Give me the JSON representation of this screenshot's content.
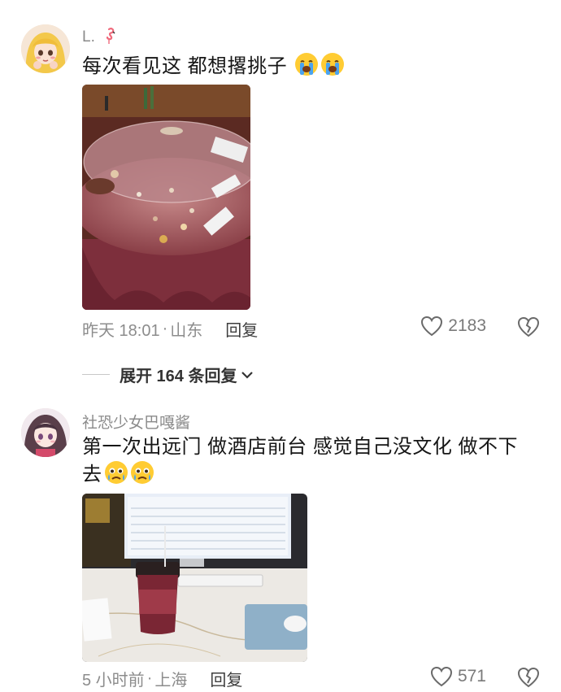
{
  "comments": [
    {
      "username": "L.",
      "username_icon": "flamingo-icon",
      "text": "每次看见这  都想撂挑子",
      "emoji": "loudly-crying-face",
      "photo_desc": "messy-banquet-table",
      "time": "昨天 18:01",
      "separator": "·",
      "location": "山东",
      "reply_label": "回复",
      "likes": "2183",
      "expand_label": "展开 164 条回复"
    },
    {
      "username": "社恐少女巴嘎酱",
      "text": "第一次出远门 做酒店前台 感觉自己没文化 做不下去",
      "emoji": "crying-face",
      "photo_desc": "hotel-front-desk-coffee",
      "time": "5 小时前",
      "location": "上海",
      "reply_label": "回复",
      "likes": "571"
    }
  ],
  "colors": {
    "meta_text": "#8c8c8c",
    "username": "#8a8a8a",
    "body_text": "#161616"
  }
}
